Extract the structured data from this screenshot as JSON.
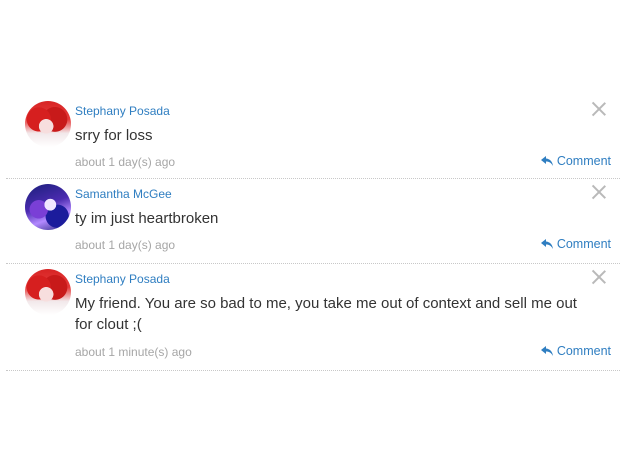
{
  "comments": [
    {
      "author": "Stephany Posada",
      "avatar_icon": "avatar-red-hair-icon",
      "text": "srry for loss",
      "time": "about 1 day(s) ago",
      "reply_label": "Comment"
    },
    {
      "author": "Samantha McGee",
      "avatar_icon": "avatar-blue-icon",
      "text": "ty im just heartbroken",
      "time": "about 1 day(s) ago",
      "reply_label": "Comment"
    },
    {
      "author": "Stephany Posada",
      "avatar_icon": "avatar-red-hair-icon",
      "text": "My friend. You are so bad to me, you take me out of context and sell me out for clout ;(",
      "time": "about 1 minute(s) ago",
      "reply_label": "Comment"
    }
  ],
  "colors": {
    "link": "#2f7ec1",
    "meta": "#a6a6a6",
    "text": "#333333"
  }
}
